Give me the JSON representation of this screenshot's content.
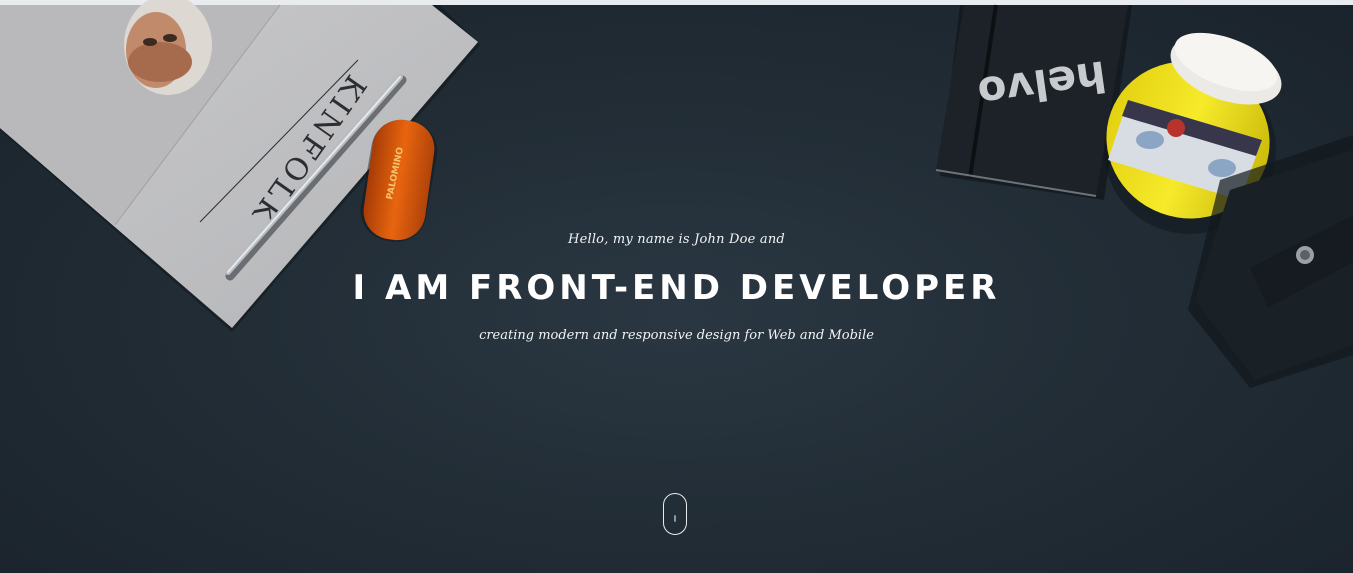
{
  "hero": {
    "intro": "Hello, my name is John Doe and",
    "headline": "I AM FRONT-END DEVELOPER",
    "subline": "creating modern and responsive design for Web and Mobile"
  },
  "background": {
    "magazine_title": "KINFOLK",
    "sharpener_brand": "PALOMINO",
    "notebook_brand": "helvo",
    "colors": {
      "desk": "#222d36",
      "paint_jar": "#f2e21a",
      "sharpener": "#d4580f"
    }
  },
  "scroll": {
    "icon": "mouse-scroll-icon"
  }
}
